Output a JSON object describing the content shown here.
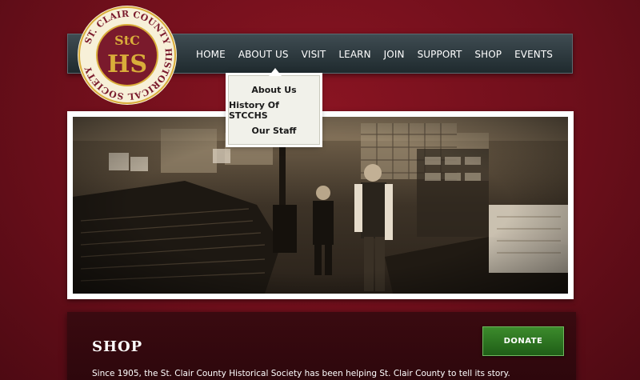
{
  "logo": {
    "ring_text": "ST. CLAIR COUNTY HISTORICAL SOCIETY",
    "monogram_top": "StC",
    "monogram_bottom": "HS",
    "colors": {
      "gold": "#d9ad3a",
      "maroon": "#7a1a2c",
      "cream": "#f7f0d8"
    }
  },
  "nav": {
    "items": [
      {
        "label": "HOME"
      },
      {
        "label": "ABOUT US"
      },
      {
        "label": "VISIT"
      },
      {
        "label": "LEARN"
      },
      {
        "label": "JOIN"
      },
      {
        "label": "SUPPORT"
      },
      {
        "label": "SHOP"
      },
      {
        "label": "EVENTS"
      }
    ]
  },
  "dropdown": {
    "items": [
      {
        "label": "About Us"
      },
      {
        "label": "History Of STCCHS"
      },
      {
        "label": "Our Staff"
      }
    ]
  },
  "hero": {
    "subject": "historic-store-photo"
  },
  "content": {
    "title": "SHOP",
    "donate_label": "DONATE",
    "intro": "Since 1905, the St. Clair County Historical Society has been helping St. Clair County to tell its story."
  },
  "colors": {
    "background": "#6e0f1b",
    "nav": "#2b373c",
    "donate": "#2e7a22",
    "content_panel": "#340910"
  }
}
